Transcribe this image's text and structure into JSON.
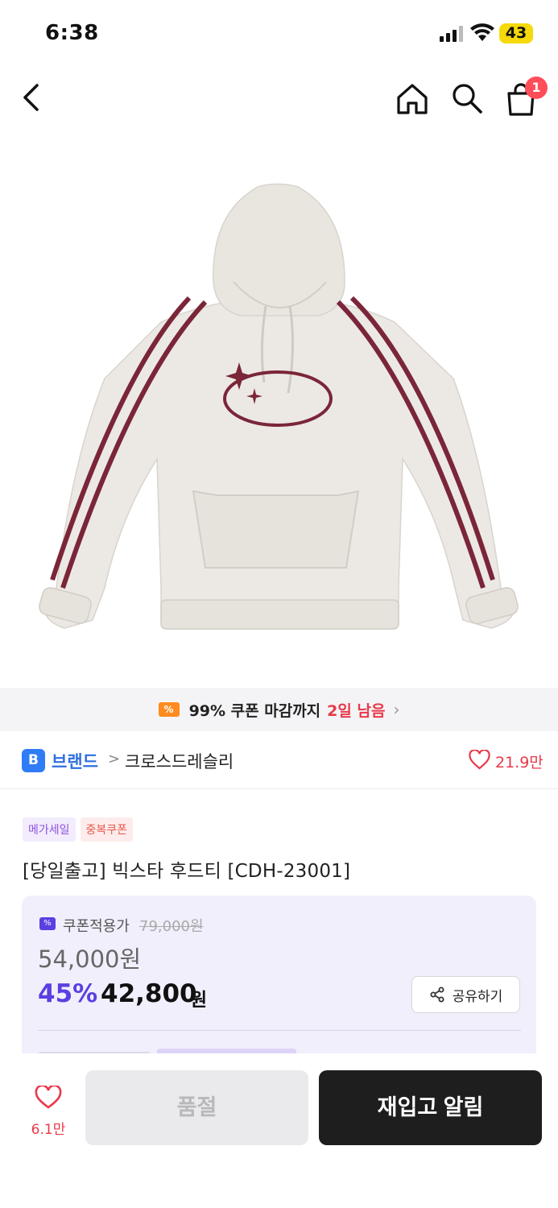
{
  "status_bar": {
    "time": "6:38",
    "battery": "43"
  },
  "nav": {
    "cart_count": "1"
  },
  "coupon_banner": {
    "text": "99% 쿠폰 마감까지",
    "remaining": "2일 남음",
    "icon_label": "%"
  },
  "brand": {
    "logo_letter": "B",
    "label": "브랜드",
    "separator": ">",
    "name": "크로스드레슬리",
    "like_count": "21.9만"
  },
  "tags": [
    "메가세일",
    "중복쿠폰"
  ],
  "product": {
    "title": "[당일출고] 빅스타 후드티 [CDH-23001]"
  },
  "price": {
    "coupon_label": "쿠폰적용가",
    "original_price": "79,000원",
    "sale_price": "54,000원",
    "discount_rate": "45%",
    "final_price": "42,800",
    "currency": "원",
    "share_label": "공유하기"
  },
  "bottom": {
    "wish_count": "6.1만",
    "soldout_label": "품절",
    "restock_label": "재입고 알림"
  },
  "colors": {
    "accent_purple": "#5b3fe0",
    "accent_red": "#e8394a",
    "brand_blue": "#2f7cf6",
    "hoodie_stripe": "#7a2638"
  }
}
